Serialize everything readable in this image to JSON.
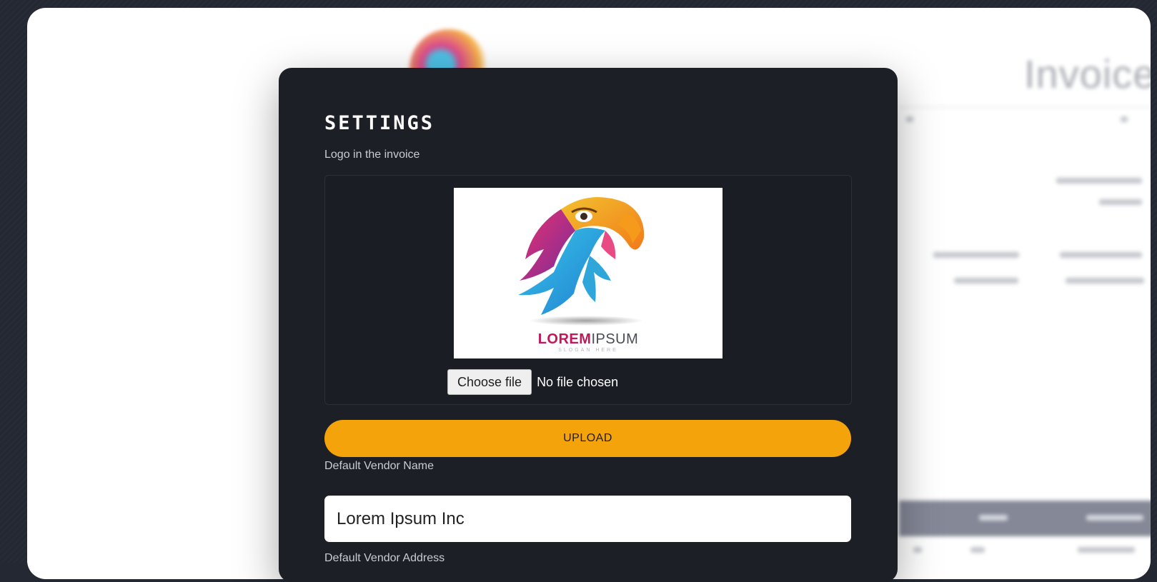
{
  "settings": {
    "title": "SETTINGS",
    "logo_label": "Logo in the invoice",
    "logo_preview": {
      "brand_strong": "LOREM",
      "brand_rest": "IPSUM",
      "slogan": "SLOGAN HERE"
    },
    "file_input": {
      "button_label": "Choose file",
      "status": "No file chosen"
    },
    "upload_label": "UPLOAD",
    "vendor_name_label": "Default Vendor Name",
    "vendor_name_value": "Lorem Ipsum Inc",
    "vendor_address_label": "Default Vendor Address"
  },
  "background_invoice": {
    "title": "Invoice"
  },
  "colors": {
    "page_bg": "#232833",
    "modal_bg": "#1c1f26",
    "accent": "#f5a30a"
  }
}
